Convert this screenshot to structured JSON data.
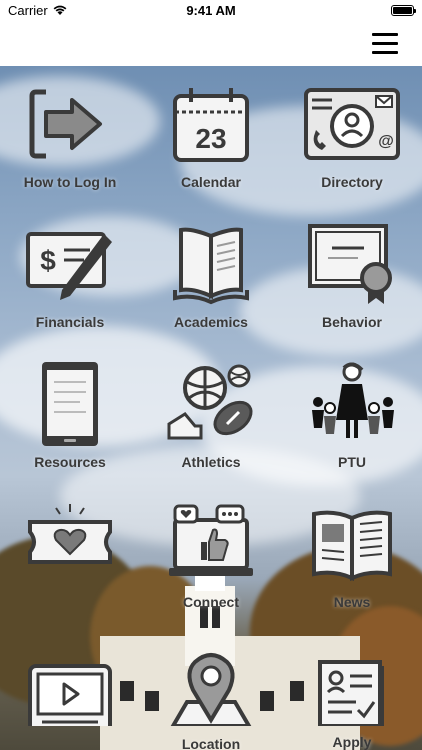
{
  "status": {
    "carrier": "Carrier",
    "time": "9:41 AM"
  },
  "nav": {
    "menu_icon": "hamburger-menu-icon"
  },
  "tiles": [
    {
      "label": "How to Log In",
      "icon": "login-icon"
    },
    {
      "label": "Calendar",
      "icon": "calendar-icon",
      "day": "23"
    },
    {
      "label": "Directory",
      "icon": "directory-icon"
    },
    {
      "label": "Financials",
      "icon": "financials-icon",
      "symbol": "$"
    },
    {
      "label": "Academics",
      "icon": "book-icon"
    },
    {
      "label": "Behavior",
      "icon": "certificate-icon"
    },
    {
      "label": "Resources",
      "icon": "tablet-icon"
    },
    {
      "label": "Athletics",
      "icon": "sports-icon"
    },
    {
      "label": "PTU",
      "icon": "family-icon"
    },
    {
      "label": "",
      "icon": "ticket-heart-icon"
    },
    {
      "label": "Connect",
      "icon": "social-icon"
    },
    {
      "label": "News",
      "icon": "newspaper-icon"
    },
    {
      "label": "",
      "icon": "video-icon"
    },
    {
      "label": "Location",
      "icon": "map-pin-icon"
    },
    {
      "label": "Apply",
      "icon": "application-icon"
    }
  ]
}
